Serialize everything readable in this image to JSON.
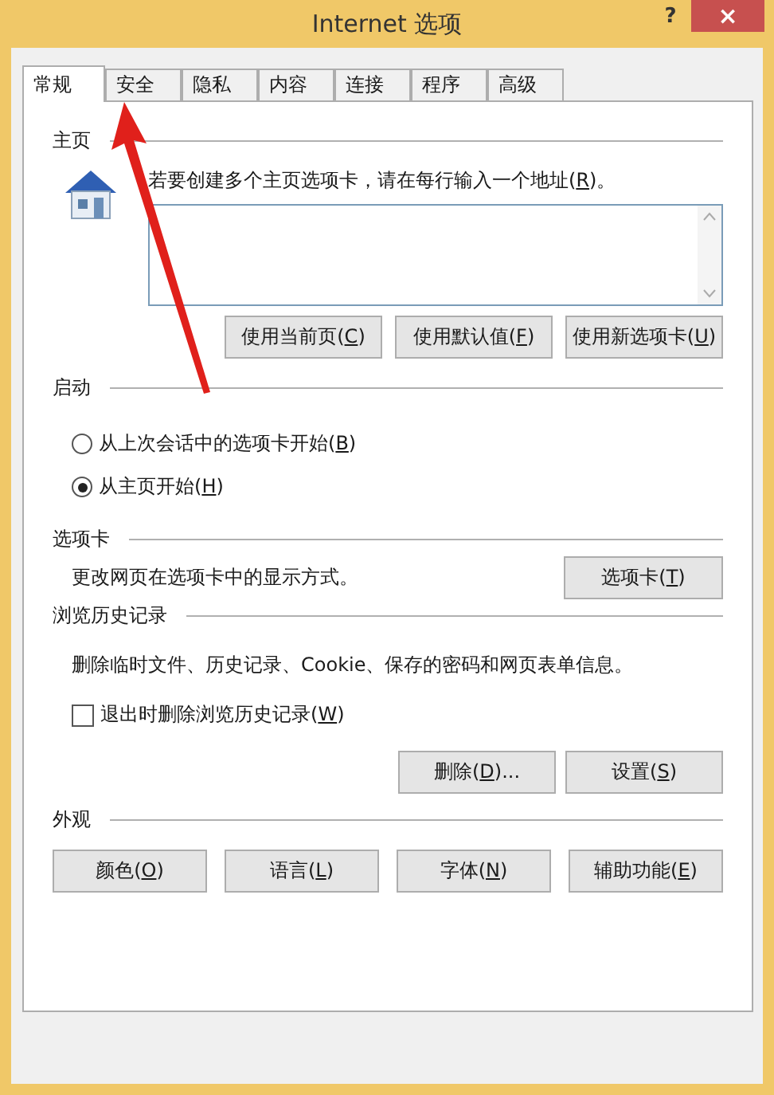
{
  "window": {
    "title": "Internet 选项",
    "help_button": "?",
    "close_button": "×"
  },
  "tabs": [
    {
      "label": "常规",
      "selected": true
    },
    {
      "label": "安全",
      "selected": false
    },
    {
      "label": "隐私",
      "selected": false
    },
    {
      "label": "内容",
      "selected": false
    },
    {
      "label": "连接",
      "selected": false
    },
    {
      "label": "程序",
      "selected": false
    },
    {
      "label": "高级",
      "selected": false
    }
  ],
  "home_page": {
    "heading": "主页",
    "hint": {
      "before": "若要创建多个主页选项卡，请在每行输入一个地址(",
      "key": "R",
      "after": ")。"
    },
    "buttons": [
      {
        "before": "使用当前页(",
        "key": "C",
        "after": ")"
      },
      {
        "before": "使用默认值(",
        "key": "F",
        "after": ")"
      },
      {
        "before": "使用新选项卡(",
        "key": "U",
        "after": ")"
      }
    ]
  },
  "startup": {
    "heading": "启动",
    "options": [
      {
        "before": "从上次会话中的选项卡开始(",
        "key": "B",
        "after": ")",
        "selected": false
      },
      {
        "before": "从主页开始(",
        "key": "H",
        "after": ")",
        "selected": true
      }
    ]
  },
  "tabs_section": {
    "heading": "选项卡",
    "description": "更改网页在选项卡中的显示方式。",
    "button": {
      "before": "选项卡(",
      "key": "T",
      "after": ")"
    }
  },
  "history": {
    "heading": "浏览历史记录",
    "description": "删除临时文件、历史记录、Cookie、保存的密码和网页表单信息。",
    "checkbox": {
      "before": "退出时删除浏览历史记录(",
      "key": "W",
      "after": ")",
      "checked": false
    },
    "buttons": [
      {
        "before": "删除(",
        "key": "D",
        "after": ")..."
      },
      {
        "before": "设置(",
        "key": "S",
        "after": ")"
      }
    ]
  },
  "appearance": {
    "heading": "外观",
    "buttons": [
      {
        "before": "颜色(",
        "key": "O",
        "after": ")"
      },
      {
        "before": "语言(",
        "key": "L",
        "after": ")"
      },
      {
        "before": "字体(",
        "key": "N",
        "after": ")"
      },
      {
        "before": "辅助功能(",
        "key": "E",
        "after": ")"
      }
    ]
  }
}
